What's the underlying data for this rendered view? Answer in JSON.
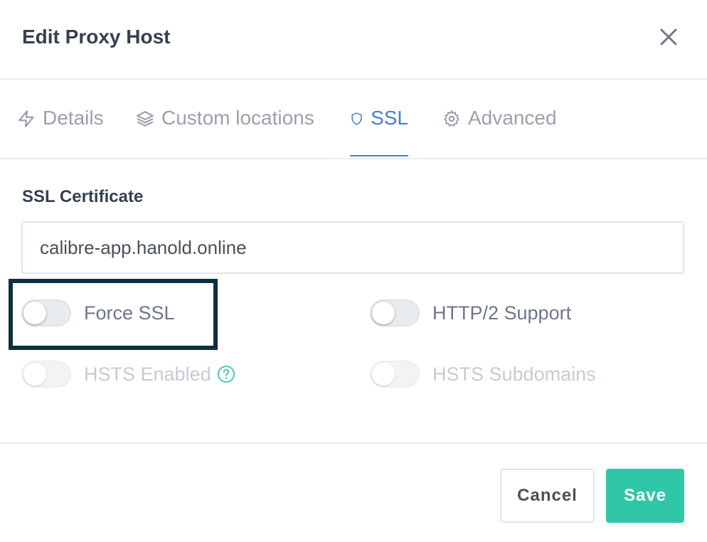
{
  "modal": {
    "title": "Edit Proxy Host"
  },
  "tabs": [
    {
      "label": "Details",
      "icon": "bolt-icon",
      "active": false
    },
    {
      "label": "Custom locations",
      "icon": "layers-icon",
      "active": false
    },
    {
      "label": "SSL",
      "icon": "shield-icon",
      "active": true
    },
    {
      "label": "Advanced",
      "icon": "gear-icon",
      "active": false
    }
  ],
  "ssl": {
    "certificate_label": "SSL Certificate",
    "certificate_value": "calibre-app.hanold.online",
    "options": {
      "force_ssl": {
        "label": "Force SSL",
        "enabled": false,
        "disabled": false
      },
      "http2": {
        "label": "HTTP/2 Support",
        "enabled": false,
        "disabled": false
      },
      "hsts": {
        "label": "HSTS Enabled",
        "enabled": false,
        "disabled": true
      },
      "hsts_subdomains": {
        "label": "HSTS Subdomains",
        "enabled": false,
        "disabled": true
      }
    }
  },
  "footer": {
    "cancel_label": "Cancel",
    "save_label": "Save"
  },
  "colors": {
    "accent": "#467fcf",
    "save": "#2fc7a8",
    "highlight": "#0e2f40",
    "help": "#45c8b4"
  }
}
